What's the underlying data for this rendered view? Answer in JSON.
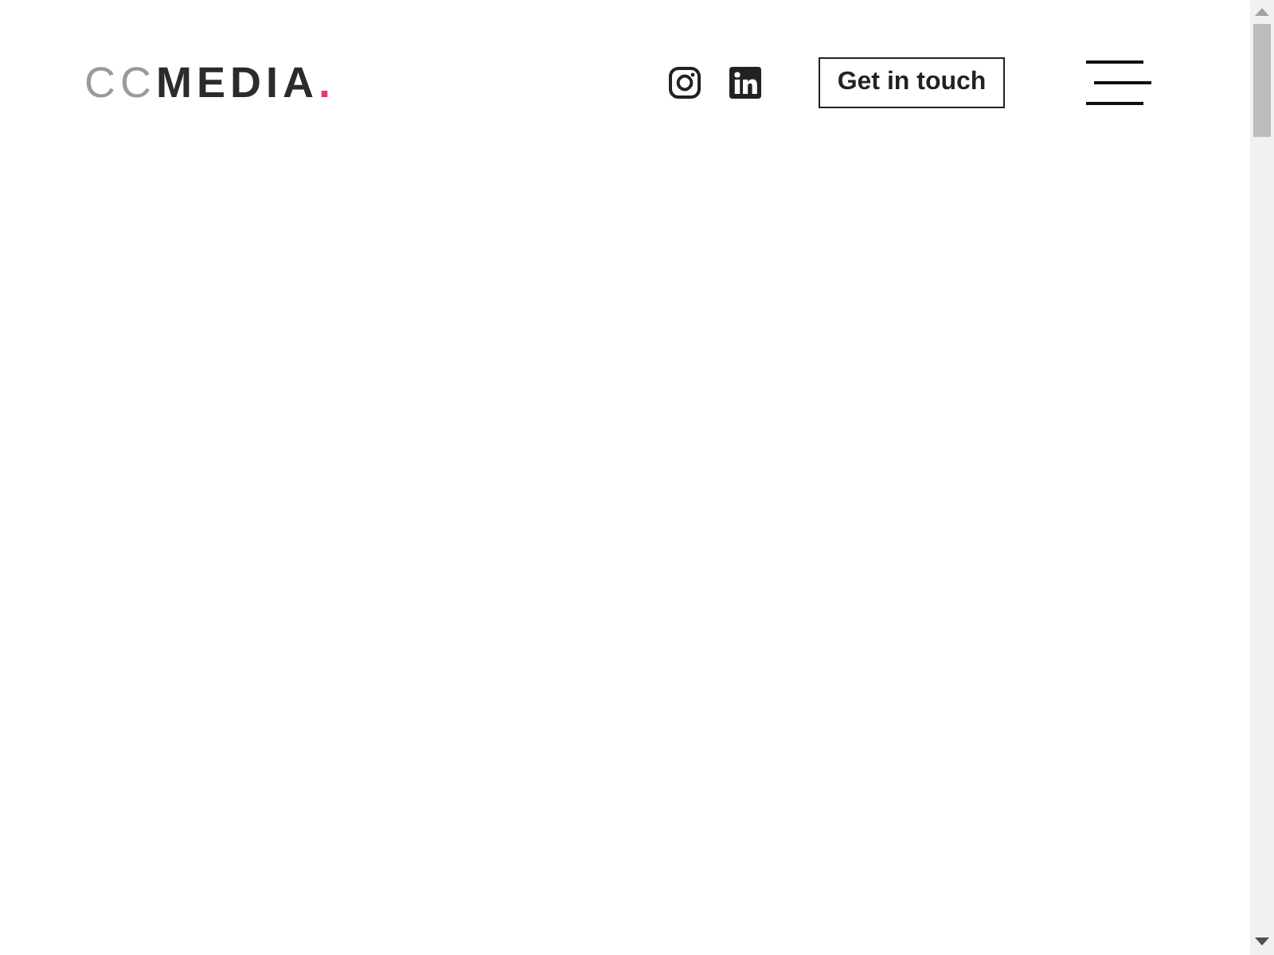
{
  "header": {
    "logo": {
      "light": "CC",
      "bold": "MEDIA",
      "dot": "."
    },
    "social_links": [
      {
        "kind": "instagram"
      },
      {
        "kind": "linkedin"
      }
    ],
    "cta_button": {
      "label": "Get in touch"
    }
  }
}
